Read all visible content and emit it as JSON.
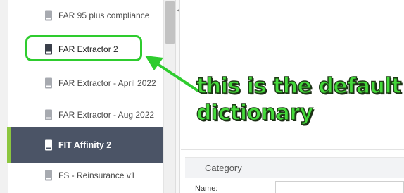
{
  "sidebar": {
    "items": [
      {
        "label": "FAR 95 plus compliance"
      },
      {
        "label": "FAR Extractor 2"
      },
      {
        "label": "FAR Extractor - April 2022"
      },
      {
        "label": "FAR Extractor - Aug 2022"
      },
      {
        "label": "FIT Affinity 2"
      },
      {
        "label": "FS - Reinsurance v1"
      }
    ],
    "highlighted_index": 1,
    "active_index": 4
  },
  "annotation": {
    "line1": "this is the default",
    "line2": "dictionary"
  },
  "panel": {
    "category_label": "Category",
    "name_label": "Name:",
    "name_value": ""
  },
  "colors": {
    "accent_green": "#8cc63f",
    "highlight_green": "#2ecc2e",
    "active_bg": "#4b5466",
    "annotation_text": "#44d93a"
  }
}
